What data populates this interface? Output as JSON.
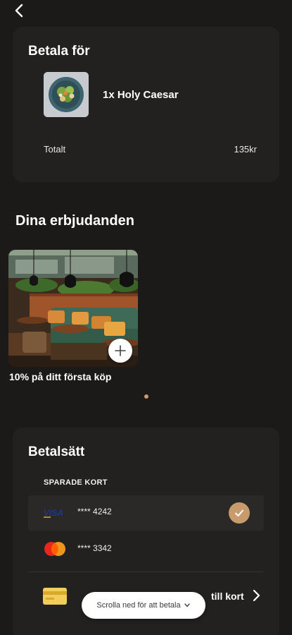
{
  "pay_for": {
    "title": "Betala för",
    "item": "1x Holy Caesar",
    "total_label": "Totalt",
    "total_value": "135kr"
  },
  "offers": {
    "title": "Dina erbjudanden",
    "items": [
      {
        "label": "10% på ditt första köp",
        "icon": "plus-icon"
      }
    ],
    "page_count": 1,
    "active_page": 1
  },
  "payment": {
    "title": "Betalsätt",
    "saved_label": "SPARADE KORT",
    "cards": [
      {
        "brand": "visa",
        "number": "**** 4242",
        "selected": true
      },
      {
        "brand": "mastercard",
        "number": "**** 3342",
        "selected": false
      }
    ],
    "add_card_label": "till kort"
  },
  "scroll_hint": "Scrolla ned för att betala",
  "colors": {
    "background": "#1b1a19",
    "card": "#232120",
    "accent": "#c89b6c"
  }
}
